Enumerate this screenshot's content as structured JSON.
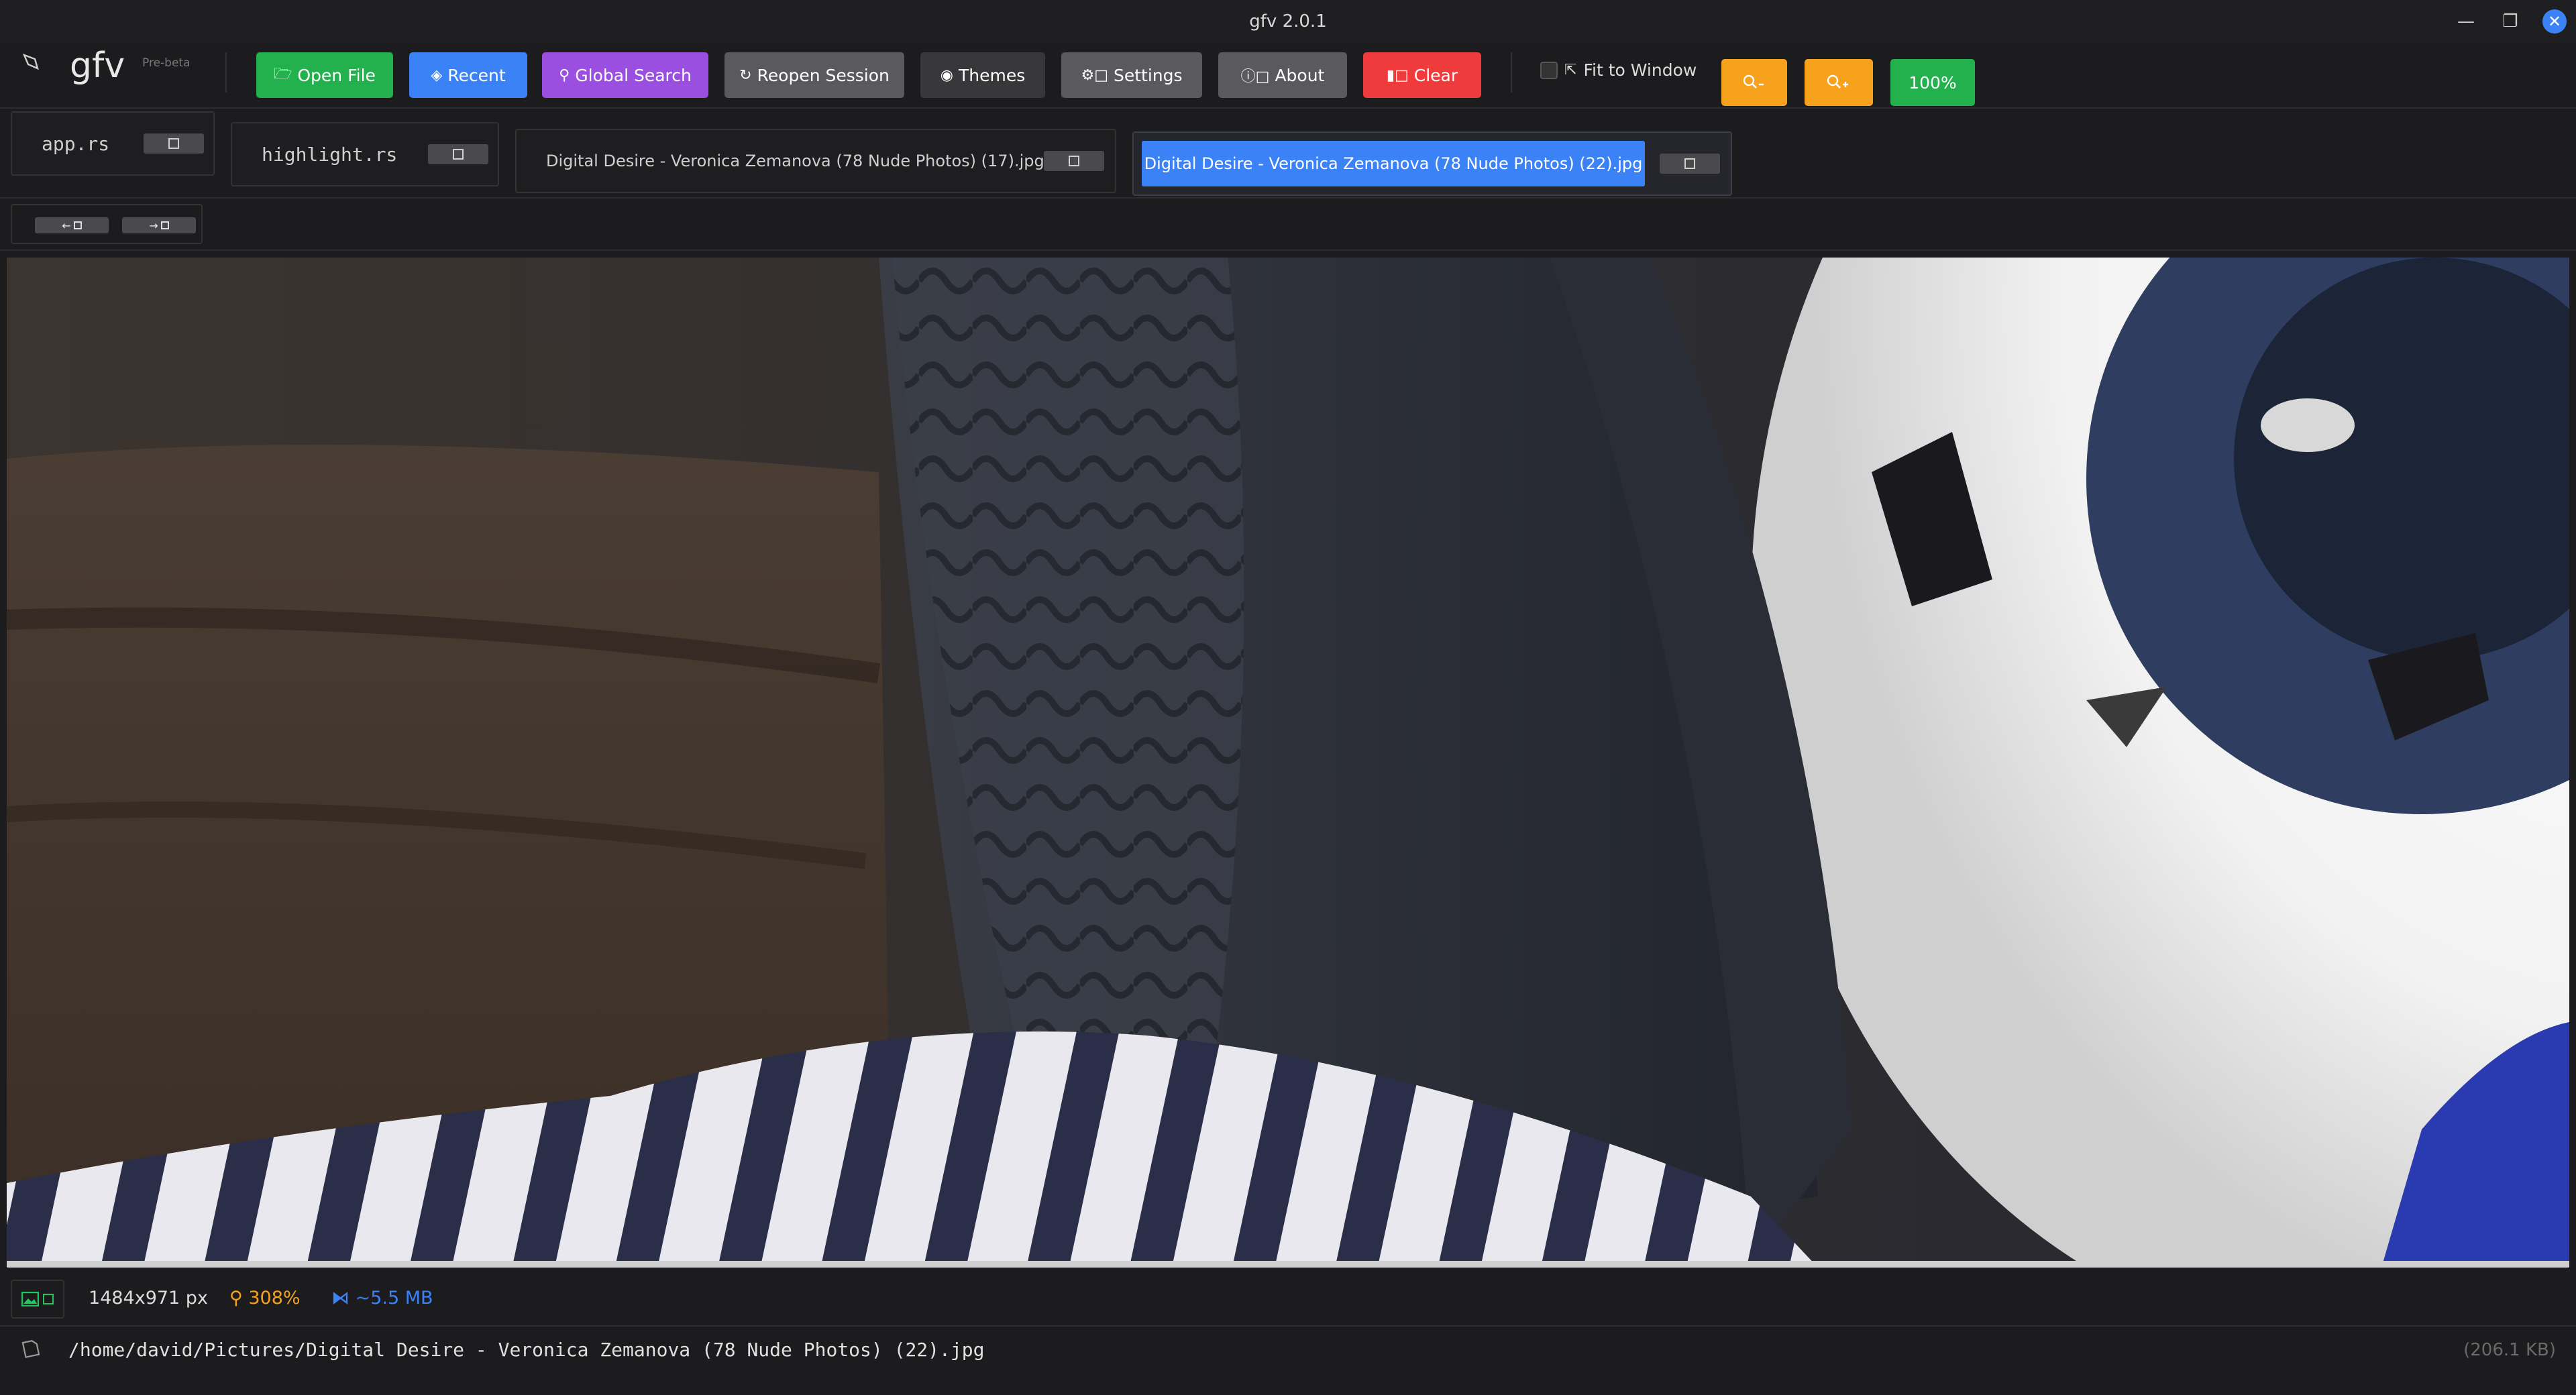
{
  "window": {
    "title": "gfv 2.0.1"
  },
  "toolbar": {
    "app_name": "gfv",
    "app_badge": "Pre-beta",
    "open_file": "Open File",
    "recent": "Recent",
    "global_search": "Global Search",
    "reopen_session": "Reopen Session",
    "themes": "Themes",
    "settings": "Settings",
    "about": "About",
    "clear": "Clear",
    "fit_to_window": "Fit to Window",
    "fit_to_window_checked": false,
    "zoom_out_icon": "zoom-out-icon",
    "zoom_in_icon": "zoom-in-icon",
    "zoom_reset": "100%"
  },
  "tabs": [
    {
      "label": "app.rs",
      "active": false
    },
    {
      "label": "highlight.rs",
      "active": false
    },
    {
      "label": "Digital Desire - Veronica Zemanova (78 Nude Photos) (17).jpg",
      "active": false
    },
    {
      "label": "Digital Desire - Veronica Zemanova (78 Nude Photos) (22).jpg",
      "active": true
    }
  ],
  "nav": {
    "prev_icon": "arrow-left-icon",
    "next_icon": "arrow-right-icon"
  },
  "status": {
    "dimensions": "1484x971 px",
    "zoom": "308%",
    "memory": "~5.5 MB"
  },
  "path": {
    "full_path": "/home/david/Pictures/Digital Desire - Veronica Zemanova (78 Nude Photos) (22).jpg",
    "file_size": "(206.1 KB)"
  },
  "colors": {
    "accent_blue": "#3b82f6",
    "green": "#22b14c",
    "purple": "#9b4fe0",
    "red": "#ef3b3b",
    "orange": "#f6a21d",
    "zoom_text": "#f6a21d",
    "memory_text": "#3b82f6"
  }
}
